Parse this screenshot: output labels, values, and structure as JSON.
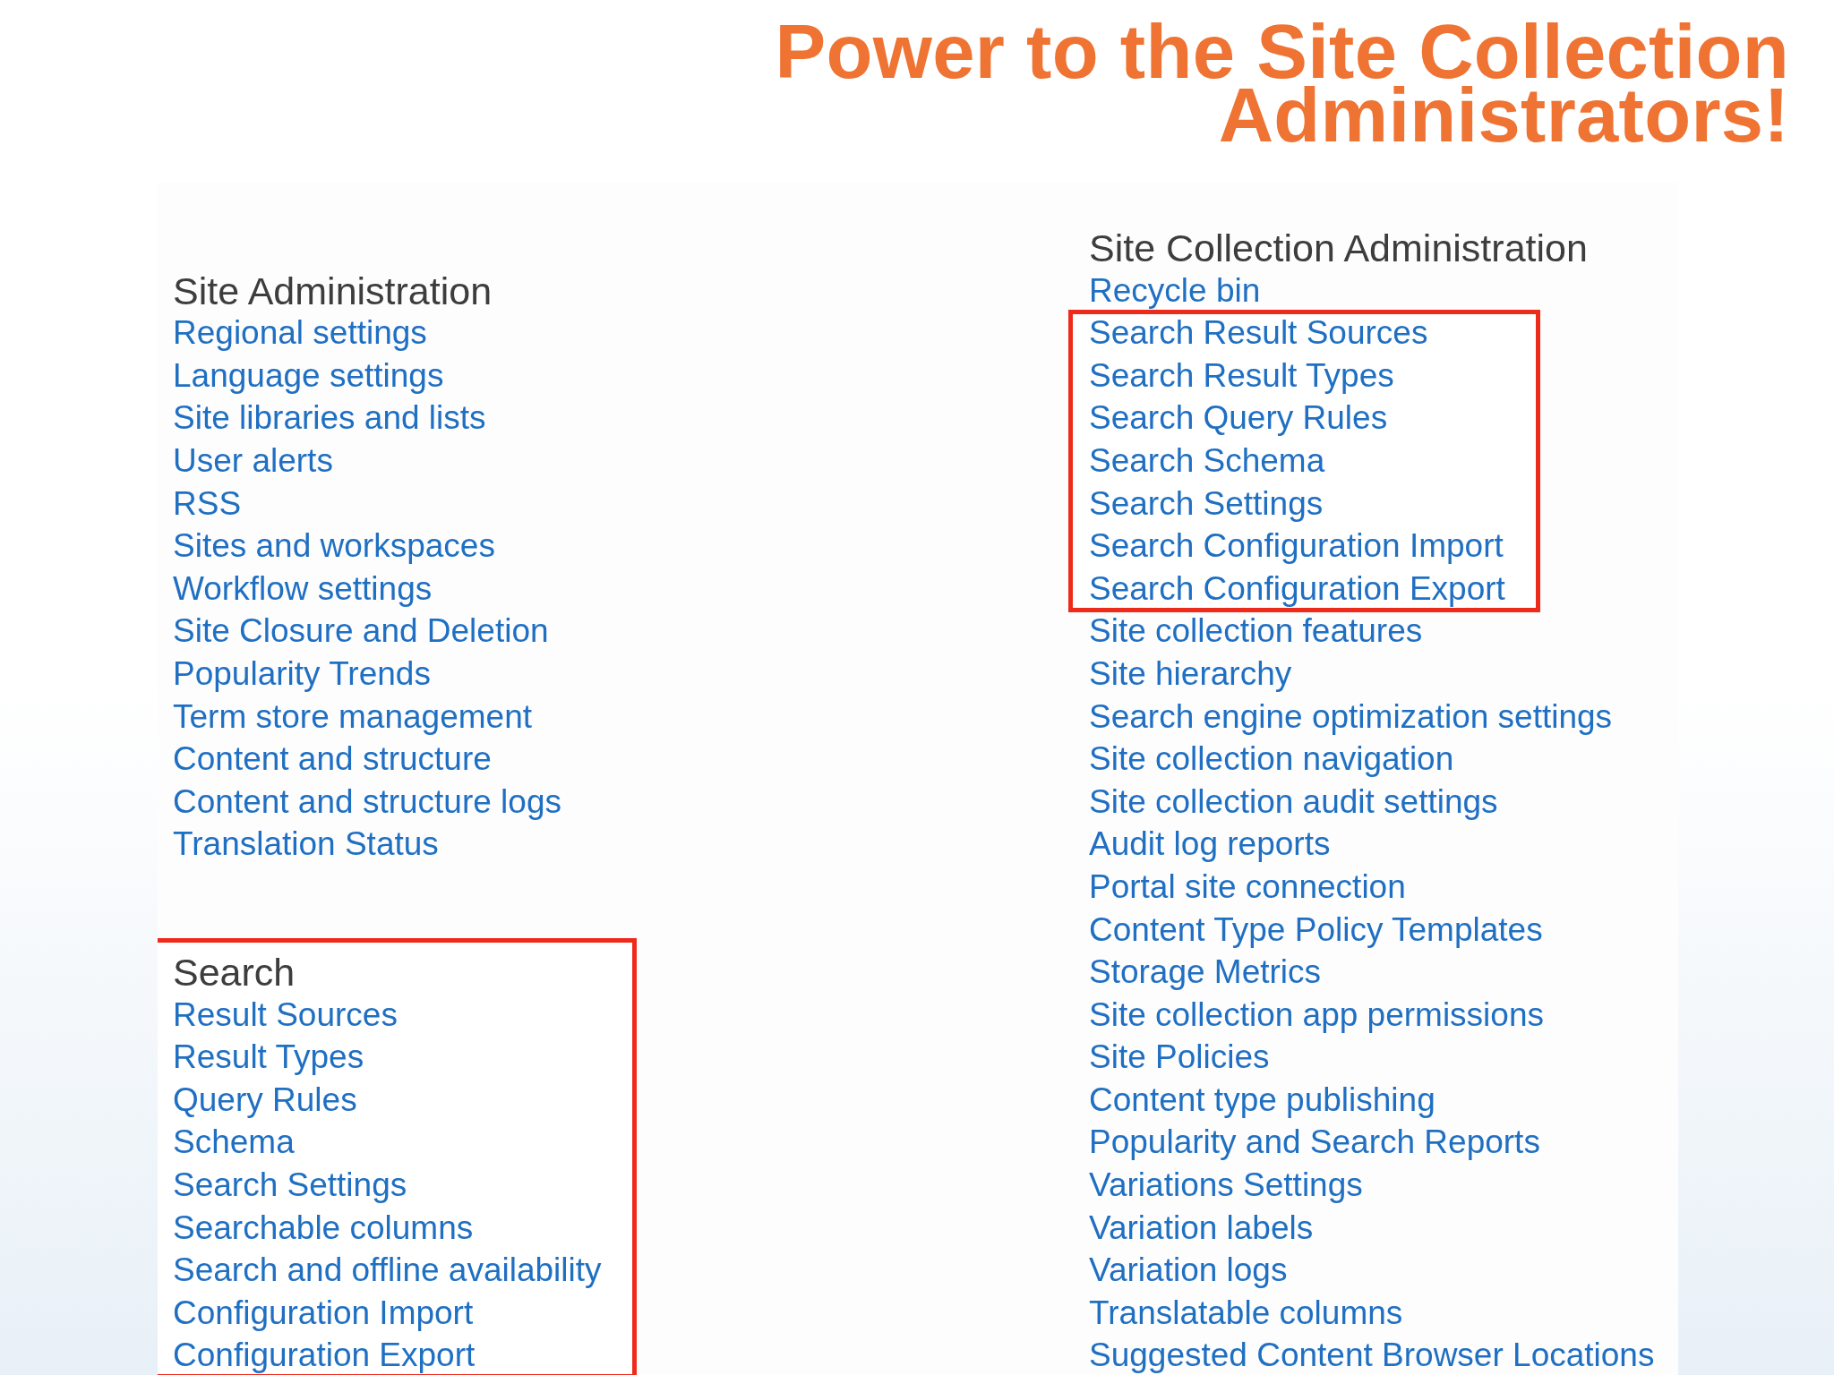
{
  "title": "Power to the Site Collection Administrators!",
  "columns": [
    {
      "blocks": [
        {
          "heading": "Site Administration",
          "highlighted": false,
          "links": [
            "Regional settings",
            "Language settings",
            "Site libraries and lists",
            "User alerts",
            "RSS",
            "Sites and workspaces",
            "Workflow settings",
            "Site Closure and Deletion",
            "Popularity Trends",
            "Term store management",
            "Content and structure",
            "Content and structure logs",
            "Translation Status"
          ]
        },
        {
          "heading": "Search",
          "highlighted": true,
          "links": [
            "Result Sources",
            "Result Types",
            "Query Rules",
            "Schema",
            "Search Settings",
            "Searchable columns",
            "Search and offline availability",
            "Configuration Import",
            "Configuration Export"
          ]
        }
      ]
    },
    {
      "blocks": [
        {
          "heading": "Site Collection Administration",
          "highlighted": false,
          "links": [
            "Recycle bin"
          ]
        },
        {
          "highlighted": true,
          "links": [
            "Search Result Sources",
            "Search Result Types",
            "Search Query Rules",
            "Search Schema",
            "Search Settings",
            "Search Configuration Import",
            "Search Configuration Export"
          ]
        },
        {
          "highlighted": false,
          "links": [
            "Site collection features",
            "Site hierarchy",
            "Search engine optimization settings",
            "Site collection navigation",
            "Site collection audit settings",
            "Audit log reports",
            "Portal site connection",
            "Content Type Policy Templates",
            "Storage Metrics",
            "Site collection app permissions",
            "Site Policies",
            "Content type publishing",
            "Popularity and Search Reports",
            "Variations Settings",
            "Variation labels",
            "Variation logs",
            "Translatable columns",
            "Suggested Content Browser Locations"
          ]
        }
      ]
    }
  ]
}
